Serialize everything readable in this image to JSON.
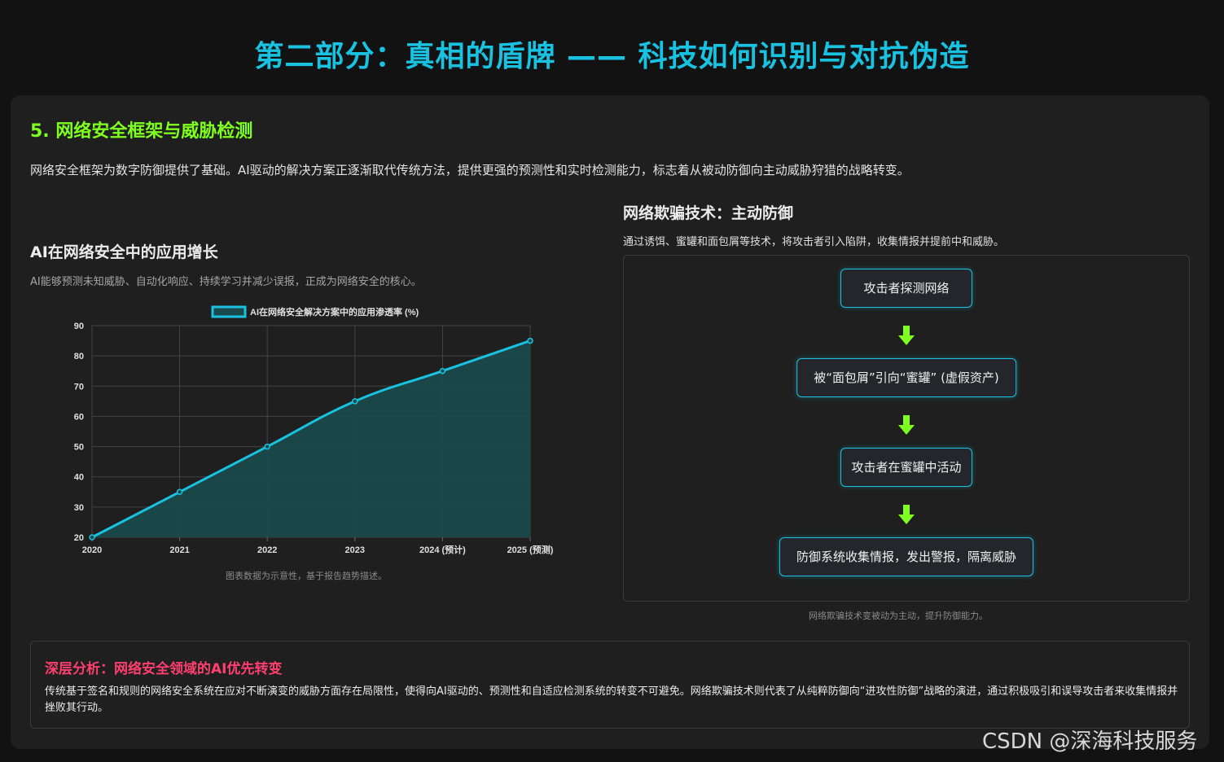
{
  "page_title": "第二部分：真相的盾牌 —— 科技如何识别与对抗伪造",
  "section": {
    "title": "5. 网络安全框架与威胁检测",
    "description": "网络安全框架为数字防御提供了基础。AI驱动的解决方案正逐渐取代传统方法，提供更强的预测性和实时检测能力，标志着从被动防御向主动威胁狩猎的战略转变。"
  },
  "left": {
    "title": "AI在网络安全中的应用增长",
    "description": "AI能够预测未知威胁、自动化响应、持续学习并减少误报，正成为网络安全的核心。",
    "note": "图表数据为示意性，基于报告趋势描述。"
  },
  "chart_data": {
    "type": "area",
    "categories": [
      "2020",
      "2021",
      "2022",
      "2023",
      "2024 (预计)",
      "2025 (预测)"
    ],
    "series": [
      {
        "name": "AI在网络安全解决方案中的应用渗透率 (%)",
        "values": [
          20,
          35,
          50,
          65,
          75,
          85
        ]
      }
    ],
    "ylim": [
      20,
      90
    ],
    "yticks": [
      20,
      30,
      40,
      50,
      60,
      70,
      80,
      90
    ],
    "grid": true,
    "legend": "top",
    "colors": {
      "line": "#19c2e0",
      "fill": "#1a4a4c"
    }
  },
  "right": {
    "title": "网络欺骗技术：主动防御",
    "description": "通过诱饵、蜜罐和面包屑等技术，将攻击者引入陷阱，收集情报并提前中和威胁。",
    "steps": [
      "攻击者探测网络",
      "被“面包屑”引向“蜜罐” (虚假资产)",
      "攻击者在蜜罐中活动",
      "防御系统收集情报，发出警报，隔离威胁"
    ],
    "note": "网络欺骗技术变被动为主动，提升防御能力。"
  },
  "analysis": {
    "title": "深层分析：网络安全领域的AI优先转变",
    "text": "传统基于签名和规则的网络安全系统在应对不断演变的威胁方面存在局限性，使得向AI驱动的、预测性和自适应检测系统的转变不可避免。网络欺骗技术则代表了从纯粹防御向“进攻性防御”战略的演进，通过积极吸引和误导攻击者来收集情报并挫败其行动。"
  },
  "watermark": "CSDN @深海科技服务",
  "colors": {
    "accent": "#19c2e0",
    "section_title": "#7fff1f",
    "analysis_title": "#ff3f6e",
    "arrow": "#7fff1f"
  },
  "icons": {
    "flow_arrow": "down-arrow-icon"
  }
}
